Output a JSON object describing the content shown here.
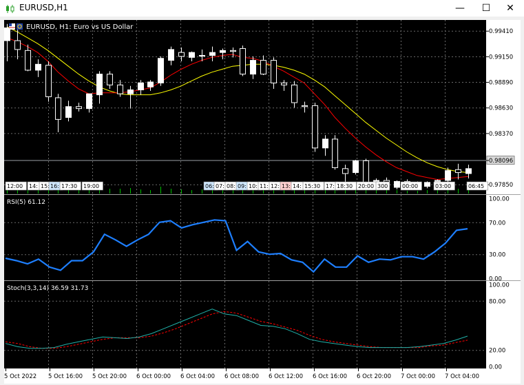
{
  "window": {
    "title": "EURUSD,H1",
    "minimize_glyph": "—",
    "maximize_glyph": "☐",
    "close_glyph": "✕",
    "app_icon": "candlestick-chart-icon"
  },
  "main": {
    "symbol_label": "EURUSD, H1:  Euro vs US Dollar",
    "price_ticks": [
      "0.99410",
      "0.99150",
      "0.98890",
      "0.98630",
      "0.98370",
      "0.98096",
      "0.97850"
    ],
    "current_price": "0.98096",
    "time_labels": [
      "12:00",
      "14:",
      "15:",
      "16:",
      "17:30",
      "19:00",
      "06:",
      "07:",
      "08:",
      "09:",
      "10:",
      "11:",
      "12:",
      "13:",
      "14:",
      "15:30",
      "17:",
      "18:30",
      "20:00",
      "300",
      "00:00",
      "03:00",
      "06:45"
    ]
  },
  "rsi": {
    "label": "RSI(5) 61.12",
    "ticks": [
      "100.00",
      "70.00",
      "30.00",
      "0.00"
    ]
  },
  "stoch": {
    "label": "Stoch(3,3,14) 36.59 31.73",
    "ticks": [
      "100.00",
      "80.00",
      "20.00",
      "0.00"
    ]
  },
  "x_axis": [
    "5 Oct 2022",
    "5 Oct 16:00",
    "5 Oct 20:00",
    "6 Oct 00:00",
    "6 Oct 04:00",
    "6 Oct 08:00",
    "6 Oct 12:00",
    "6 Oct 16:00",
    "6 Oct 20:00",
    "7 Oct 00:00",
    "7 Oct 04:00"
  ],
  "chart_data": {
    "type": "candlestick",
    "candles": [
      {
        "o": 0.9931,
        "h": 0.9948,
        "l": 0.991,
        "c": 0.9944
      },
      {
        "o": 0.9931,
        "h": 0.9942,
        "l": 0.9912,
        "c": 0.9922
      },
      {
        "o": 0.9921,
        "h": 0.9927,
        "l": 0.99,
        "c": 0.9901
      },
      {
        "o": 0.9901,
        "h": 0.9912,
        "l": 0.9894,
        "c": 0.9907
      },
      {
        "o": 0.9906,
        "h": 0.991,
        "l": 0.9869,
        "c": 0.9874
      },
      {
        "o": 0.9873,
        "h": 0.9877,
        "l": 0.9838,
        "c": 0.9851
      },
      {
        "o": 0.9853,
        "h": 0.987,
        "l": 0.9849,
        "c": 0.9864
      },
      {
        "o": 0.9864,
        "h": 0.9868,
        "l": 0.9859,
        "c": 0.9862
      },
      {
        "o": 0.9862,
        "h": 0.9875,
        "l": 0.9858,
        "c": 0.9877
      },
      {
        "o": 0.9876,
        "h": 0.99,
        "l": 0.9867,
        "c": 0.9897
      },
      {
        "o": 0.9897,
        "h": 0.99,
        "l": 0.9882,
        "c": 0.9886
      },
      {
        "o": 0.9886,
        "h": 0.9891,
        "l": 0.9874,
        "c": 0.9877
      },
      {
        "o": 0.9877,
        "h": 0.9885,
        "l": 0.9862,
        "c": 0.9881
      },
      {
        "o": 0.9881,
        "h": 0.9891,
        "l": 0.9876,
        "c": 0.9888
      },
      {
        "o": 0.9884,
        "h": 0.9891,
        "l": 0.988,
        "c": 0.9889
      },
      {
        "o": 0.9888,
        "h": 0.9915,
        "l": 0.9885,
        "c": 0.9913
      },
      {
        "o": 0.9911,
        "h": 0.9925,
        "l": 0.9906,
        "c": 0.9922
      },
      {
        "o": 0.9919,
        "h": 0.9924,
        "l": 0.991,
        "c": 0.9915
      },
      {
        "o": 0.9914,
        "h": 0.992,
        "l": 0.991,
        "c": 0.9919
      },
      {
        "o": 0.9916,
        "h": 0.9922,
        "l": 0.991,
        "c": 0.9916
      },
      {
        "o": 0.9916,
        "h": 0.9925,
        "l": 0.991,
        "c": 0.9919
      },
      {
        "o": 0.9919,
        "h": 0.9923,
        "l": 0.9912,
        "c": 0.9921
      },
      {
        "o": 0.9921,
        "h": 0.9924,
        "l": 0.9914,
        "c": 0.992
      },
      {
        "o": 0.9923,
        "h": 0.9926,
        "l": 0.9895,
        "c": 0.9897
      },
      {
        "o": 0.9897,
        "h": 0.9915,
        "l": 0.9892,
        "c": 0.9911
      },
      {
        "o": 0.9911,
        "h": 0.9916,
        "l": 0.9896,
        "c": 0.9897
      },
      {
        "o": 0.9911,
        "h": 0.9914,
        "l": 0.9882,
        "c": 0.9888
      },
      {
        "o": 0.9888,
        "h": 0.9891,
        "l": 0.988,
        "c": 0.9886
      },
      {
        "o": 0.9886,
        "h": 0.989,
        "l": 0.9863,
        "c": 0.9868
      },
      {
        "o": 0.9865,
        "h": 0.9869,
        "l": 0.9858,
        "c": 0.9864
      },
      {
        "o": 0.9865,
        "h": 0.9868,
        "l": 0.9818,
        "c": 0.9822
      },
      {
        "o": 0.9822,
        "h": 0.9835,
        "l": 0.9814,
        "c": 0.9831
      },
      {
        "o": 0.9831,
        "h": 0.9835,
        "l": 0.98,
        "c": 0.9802
      },
      {
        "o": 0.9801,
        "h": 0.9805,
        "l": 0.9784,
        "c": 0.9796
      },
      {
        "o": 0.9797,
        "h": 0.981,
        "l": 0.9795,
        "c": 0.9809
      },
      {
        "o": 0.9809,
        "h": 0.9811,
        "l": 0.9784,
        "c": 0.9786
      },
      {
        "o": 0.9785,
        "h": 0.9791,
        "l": 0.9783,
        "c": 0.9789
      },
      {
        "o": 0.9789,
        "h": 0.9792,
        "l": 0.9781,
        "c": 0.9782
      },
      {
        "o": 0.9782,
        "h": 0.9789,
        "l": 0.978,
        "c": 0.9788
      },
      {
        "o": 0.9788,
        "h": 0.979,
        "l": 0.9784,
        "c": 0.9786
      },
      {
        "o": 0.9786,
        "h": 0.9788,
        "l": 0.9782,
        "c": 0.9783
      },
      {
        "o": 0.9783,
        "h": 0.9788,
        "l": 0.9781,
        "c": 0.9787
      },
      {
        "o": 0.9787,
        "h": 0.979,
        "l": 0.9783,
        "c": 0.9789
      },
      {
        "o": 0.9789,
        "h": 0.9802,
        "l": 0.9787,
        "c": 0.9799
      },
      {
        "o": 0.98,
        "h": 0.9806,
        "l": 0.979,
        "c": 0.9797
      },
      {
        "o": 0.9796,
        "h": 0.9805,
        "l": 0.9791,
        "c": 0.9801
      }
    ],
    "ma_fast": [
      0.9934,
      0.993,
      0.9925,
      0.9919,
      0.991,
      0.9899,
      0.989,
      0.9882,
      0.9877,
      0.9878,
      0.9878,
      0.9878,
      0.9879,
      0.9881,
      0.9883,
      0.9889,
      0.9896,
      0.9902,
      0.9907,
      0.9911,
      0.9914,
      0.9916,
      0.9917,
      0.9914,
      0.9913,
      0.991,
      0.9905,
      0.99,
      0.9894,
      0.9888,
      0.9877,
      0.9866,
      0.9853,
      0.9842,
      0.9832,
      0.9823,
      0.9815,
      0.9808,
      0.9802,
      0.9798,
      0.9794,
      0.9792,
      0.979,
      0.9791,
      0.9792,
      0.9793
    ],
    "ma_slow": [
      0.9945,
      0.994,
      0.9934,
      0.9928,
      0.9921,
      0.9913,
      0.9905,
      0.9897,
      0.989,
      0.9884,
      0.988,
      0.9877,
      0.9876,
      0.9876,
      0.9876,
      0.9878,
      0.9881,
      0.9885,
      0.989,
      0.9895,
      0.9899,
      0.9902,
      0.9905,
      0.9906,
      0.9907,
      0.9907,
      0.9906,
      0.9904,
      0.9901,
      0.9897,
      0.9891,
      0.9884,
      0.9875,
      0.9866,
      0.9857,
      0.9848,
      0.984,
      0.9832,
      0.9825,
      0.9818,
      0.9812,
      0.9807,
      0.9803,
      0.98,
      0.9798,
      0.9797
    ],
    "rsi_values": [
      25,
      22,
      18,
      24,
      14,
      10,
      22,
      22,
      33,
      55,
      48,
      40,
      48,
      55,
      70,
      72,
      63,
      67,
      70,
      73,
      72,
      35,
      46,
      33,
      30,
      31,
      23,
      20,
      8,
      24,
      14,
      14,
      28,
      20,
      24,
      23,
      27,
      27,
      24,
      33,
      44,
      60,
      62
    ],
    "stoch_main": [
      28,
      24,
      22,
      22,
      23,
      27,
      30,
      33,
      36,
      35,
      34,
      36,
      40,
      46,
      52,
      58,
      64,
      70,
      64,
      62,
      56,
      50,
      49,
      46,
      40,
      33,
      30,
      28,
      26,
      24,
      23,
      23,
      23,
      23,
      24,
      26,
      28,
      32,
      37
    ],
    "stoch_signal": [
      30,
      28,
      24,
      22,
      22,
      24,
      27,
      30,
      33,
      35,
      35,
      35,
      37,
      41,
      46,
      52,
      58,
      64,
      67,
      65,
      60,
      55,
      52,
      48,
      44,
      38,
      33,
      30,
      28,
      26,
      24,
      23,
      23,
      23,
      23,
      25,
      26,
      29,
      32
    ],
    "price_range": [
      0.9775,
      0.9952
    ],
    "colors": {
      "background": "#000000",
      "grid": "#6b6b6b",
      "bull_candle": "#ffffff",
      "bear_candle": "#000000",
      "wick": "#ffffff",
      "ma_fast": "#ff0000",
      "ma_slow": "#ffff00",
      "rsi_line": "#1e7fff",
      "stoch_main": "#20b2aa",
      "stoch_signal": "#ff0000",
      "volume": "#00c000"
    }
  }
}
